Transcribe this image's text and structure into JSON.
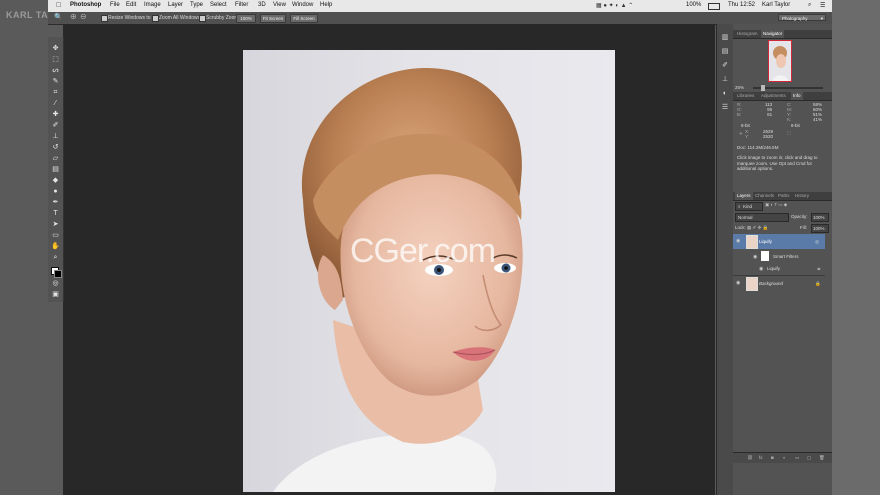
{
  "watermark_left": "KARL TAYLOR",
  "watermark_center": "CGer.com",
  "menubar": {
    "apple": "",
    "app": "Photoshop",
    "items": [
      "File",
      "Edit",
      "Image",
      "Layer",
      "Type",
      "Select",
      "Filter",
      "3D",
      "View",
      "Window",
      "Help"
    ],
    "battery": "100%",
    "clock": "Thu 12:52",
    "user": "Karl Taylor"
  },
  "options": {
    "resize_windows": "Resize Windows to Fit",
    "zoom_all": "Zoom All Windows",
    "scrubby": "Scrubby Zoom",
    "btn_100": "100%",
    "btn_fit": "Fit Screen",
    "btn_fill": "Fill Screen",
    "workspace": "Photography"
  },
  "navigator": {
    "tabs": [
      "Histogram",
      "Navigator"
    ],
    "zoom": "25%"
  },
  "info": {
    "tabs": [
      "Libraries",
      "Adjustments",
      "Info"
    ],
    "rgb": [
      "113",
      "95",
      "81"
    ],
    "cmyk": [
      "58%",
      "60%",
      "51%",
      "41%"
    ],
    "bit_left": "8-bit",
    "bit_right": "8-bit",
    "xy": [
      "2629",
      "2520"
    ],
    "doc": "Doc: 114.2M/246.5M",
    "help": "Click image to zoom in; click and drag to marquee zoom. Use Opt and Cmd for additional options."
  },
  "layers": {
    "tabs": [
      "Layers",
      "Channels",
      "Paths",
      "History"
    ],
    "kind": "Kind",
    "blend": "Normal",
    "opacity_label": "Opacity:",
    "opacity": "100%",
    "lock_label": "Lock:",
    "fill_label": "Fill:",
    "fill": "100%",
    "items": [
      "Liquify",
      "Smart Filters",
      "Liquify",
      "Background"
    ]
  },
  "colors": {
    "accent": "#5a7aa8",
    "panel": "#535353",
    "workspace": "#282828"
  }
}
